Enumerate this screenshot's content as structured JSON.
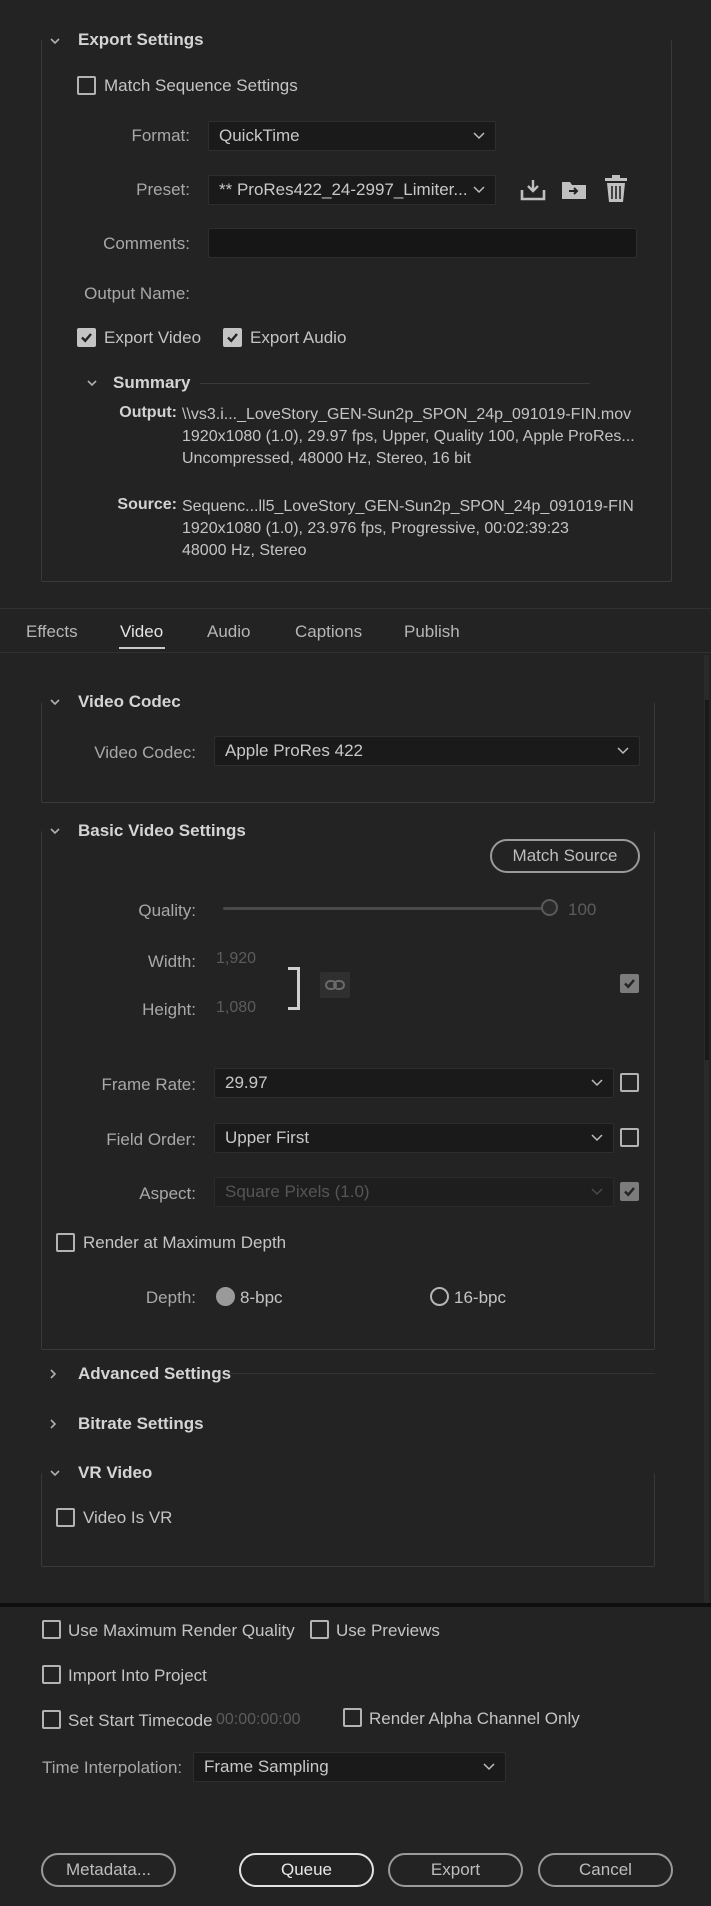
{
  "export_settings": {
    "header": "Export Settings",
    "match_sequence": {
      "label": "Match Sequence Settings",
      "checked": false
    },
    "format": {
      "label": "Format:",
      "value": "QuickTime"
    },
    "preset": {
      "label": "Preset:",
      "value": "** ProRes422_24-2997_Limiter..."
    },
    "comments": {
      "label": "Comments:",
      "value": ""
    },
    "output_name": {
      "label": "Output Name:"
    },
    "export_video": {
      "label": "Export Video",
      "checked": true
    },
    "export_audio": {
      "label": "Export Audio",
      "checked": true
    },
    "summary": {
      "header": "Summary",
      "output_key": "Output:",
      "output_lines": [
        "\\\\vs3.i..._LoveStory_GEN-Sun2p_SPON_24p_091019-FIN.mov",
        "1920x1080 (1.0), 29.97 fps, Upper, Quality 100, Apple ProRes...",
        "Uncompressed, 48000 Hz, Stereo, 16 bit"
      ],
      "source_key": "Source:",
      "source_lines": [
        "Sequenc...ll5_LoveStory_GEN-Sun2p_SPON_24p_091019-FIN",
        "1920x1080 (1.0), 23.976 fps, Progressive, 00:02:39:23",
        "48000 Hz, Stereo"
      ]
    }
  },
  "tabs": [
    {
      "label": "Effects",
      "active": false
    },
    {
      "label": "Video",
      "active": true
    },
    {
      "label": "Audio",
      "active": false
    },
    {
      "label": "Captions",
      "active": false
    },
    {
      "label": "Publish",
      "active": false
    }
  ],
  "video_codec": {
    "header": "Video Codec",
    "label": "Video Codec:",
    "value": "Apple ProRes 422"
  },
  "basic_video": {
    "header": "Basic Video Settings",
    "match_source": "Match Source",
    "quality": {
      "label": "Quality:",
      "value": "100",
      "fraction": 1.0
    },
    "width": {
      "label": "Width:",
      "value": "1,920"
    },
    "height": {
      "label": "Height:",
      "value": "1,080"
    },
    "frame_rate": {
      "label": "Frame Rate:",
      "value": "29.97"
    },
    "field_order": {
      "label": "Field Order:",
      "value": "Upper First"
    },
    "aspect": {
      "label": "Aspect:",
      "value": "Square Pixels (1.0)"
    },
    "render_max_depth": {
      "label": "Render at Maximum Depth",
      "checked": false
    },
    "depth": {
      "label": "Depth:",
      "opt1": "8-bpc",
      "opt2": "16-bpc",
      "selected": "8-bpc"
    }
  },
  "advanced_settings": {
    "header": "Advanced Settings"
  },
  "bitrate_settings": {
    "header": "Bitrate Settings"
  },
  "vr_video": {
    "header": "VR Video",
    "video_is_vr": {
      "label": "Video Is VR",
      "checked": false
    }
  },
  "bottom": {
    "use_max_render": {
      "label": "Use Maximum Render Quality",
      "checked": false
    },
    "use_previews": {
      "label": "Use Previews",
      "checked": false
    },
    "import_into_project": {
      "label": "Import Into Project",
      "checked": false
    },
    "set_start_timecode": {
      "label": "Set Start Timecode",
      "checked": false,
      "value": "00:00:00:00"
    },
    "render_alpha_only": {
      "label": "Render Alpha Channel Only",
      "checked": false
    },
    "time_interpolation": {
      "label": "Time Interpolation:",
      "value": "Frame Sampling"
    }
  },
  "buttons": {
    "metadata": "Metadata...",
    "queue": "Queue",
    "export": "Export",
    "cancel": "Cancel"
  },
  "colors": {
    "background": "#232323",
    "input_bg": "#1a1a1a",
    "text": "#b9b9b9",
    "active_tab_underline": "#c8c8c8"
  }
}
